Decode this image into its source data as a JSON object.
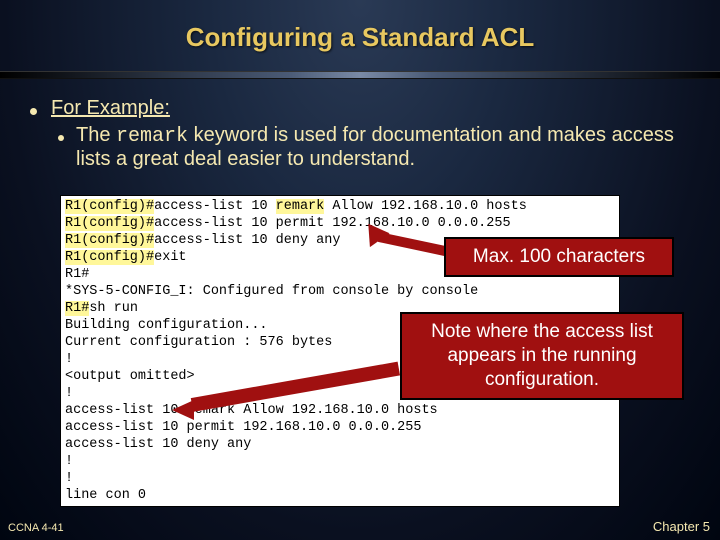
{
  "title": "Configuring a Standard ACL",
  "bullets": {
    "main": "For Example:",
    "sub_before": "The ",
    "sub_code": "remark",
    "sub_after": " keyword is used for documentation and makes access lists a great deal easier to understand."
  },
  "terminal": {
    "l1p": "R1(config)#",
    "l1a": "access-list 10 ",
    "l1r": "remark",
    "l1b": " Allow 192.168.10.0 hosts",
    "l2p": "R1(config)#",
    "l2": "access-list 10 permit 192.168.10.0 0.0.0.255",
    "l3p": "R1(config)#",
    "l3": "access-list 10 deny any",
    "l4p": "R1(config)#",
    "l4": "exit",
    "l5": "R1#",
    "l6": "*SYS-5-CONFIG_I: Configured from console by console",
    "l7a": "R1#",
    "l7b": "sh run",
    "l8": "Building configuration...",
    "blank": " ",
    "l9": "Current configuration : 576 bytes",
    "l10": "!",
    "l11": "<output omitted>",
    "l12": "!",
    "l13": "access-list 10 remark Allow 192.168.10.0 hosts",
    "l14": "access-list 10 permit 192.168.10.0 0.0.0.255",
    "l15": "access-list 10 deny   any",
    "l16": "!",
    "l17": "!",
    "l18": "line con 0"
  },
  "callouts": {
    "c1": "Max. 100 characters",
    "c2": "Note where the access list appears in the running configuration."
  },
  "footer": {
    "left": "CCNA 4-41",
    "right": "Chapter 5"
  }
}
